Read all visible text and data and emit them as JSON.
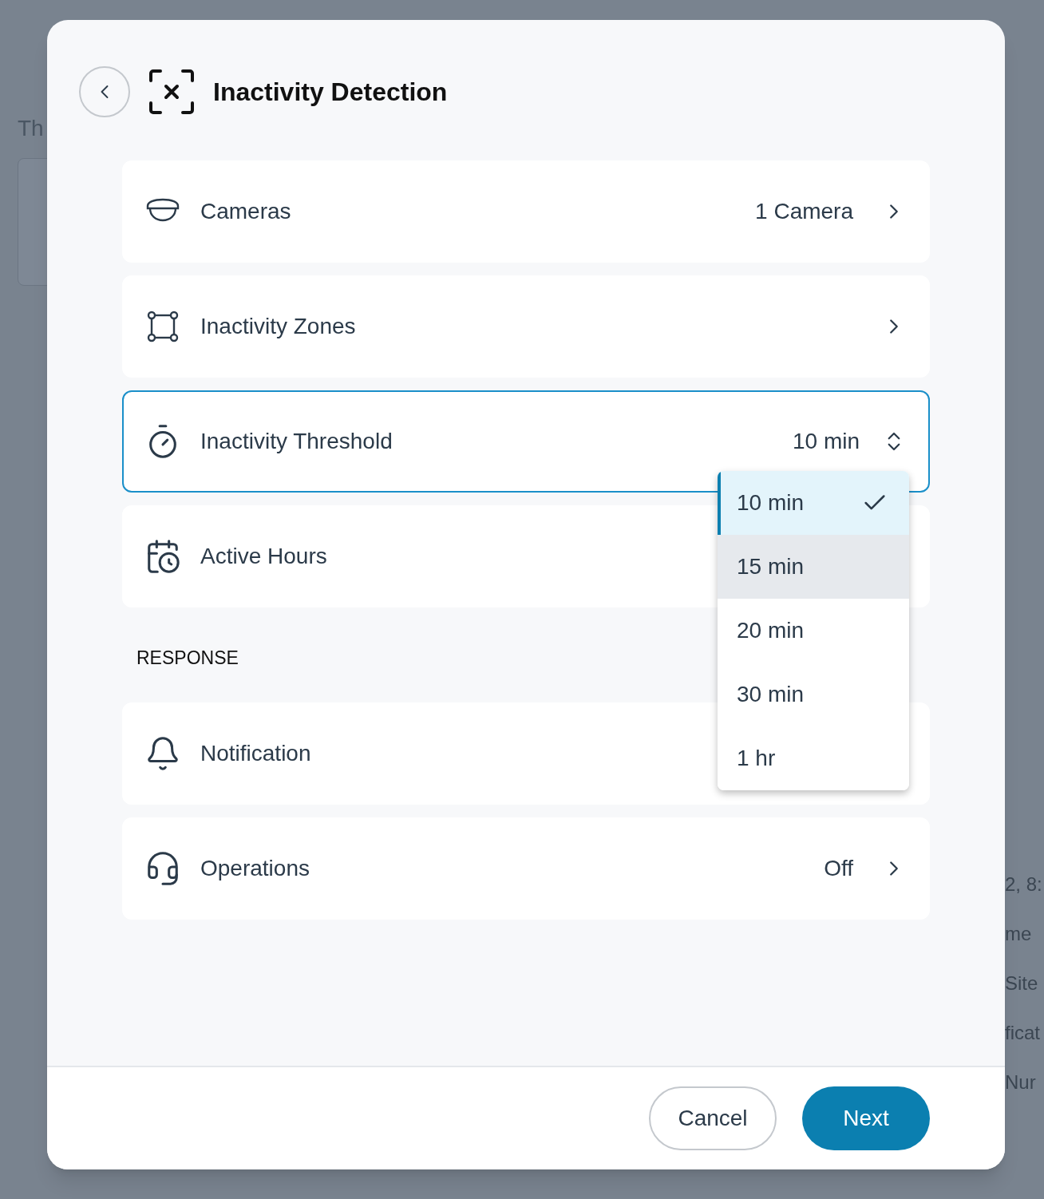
{
  "background": {
    "left_texts": [
      "Th"
    ],
    "right_texts": [
      "2, 8:",
      "me",
      "Site",
      "ficat",
      "Nur"
    ]
  },
  "dialog": {
    "title": "Inactivity Detection",
    "rows": [
      {
        "kind": "nav",
        "label": "Cameras",
        "value": "1 Camera",
        "focused": false
      },
      {
        "kind": "nav",
        "label": "Inactivity Zones",
        "focused": false
      },
      {
        "kind": "select",
        "label": "Inactivity Threshold",
        "value": "10 min",
        "focused": true
      },
      {
        "kind": "plain",
        "label": "Active Hours",
        "focused": false
      }
    ],
    "section_label": "RESPONSE",
    "response_rows": [
      {
        "kind": "plain",
        "label": "Notification",
        "focused": false
      },
      {
        "kind": "nav",
        "label": "Operations",
        "value": "Off",
        "focused": false
      }
    ],
    "dropdown": {
      "options": [
        {
          "label": "10 min",
          "selected": true,
          "hovered": false
        },
        {
          "label": "15 min",
          "selected": false,
          "hovered": true
        },
        {
          "label": "20 min",
          "selected": false,
          "hovered": false
        },
        {
          "label": "30 min",
          "selected": false,
          "hovered": false
        },
        {
          "label": "1 hr",
          "selected": false,
          "hovered": false
        }
      ]
    },
    "buttons": [
      {
        "kind": "secondary",
        "label": "Cancel"
      },
      {
        "kind": "primary",
        "label": "Next"
      }
    ]
  }
}
